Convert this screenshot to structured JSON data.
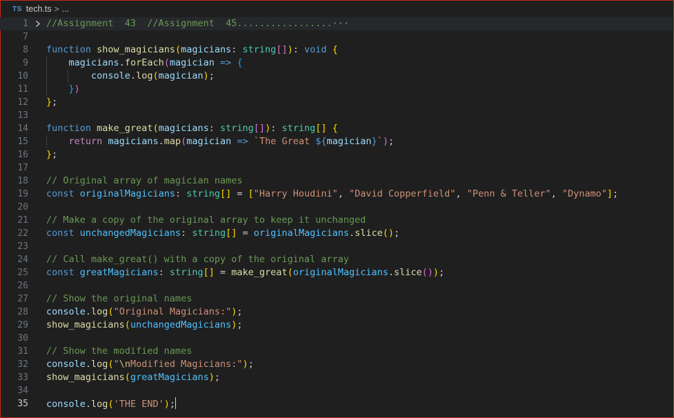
{
  "breadcrumb": {
    "lang_badge": "TS",
    "file": "tech.ts",
    "separator": ">",
    "rest": "..."
  },
  "lines": [
    {
      "n": "1",
      "tokens": [
        {
          "t": "//Assignment  43  //Assignment  45.................",
          "c": "cmt"
        },
        {
          "t": "···",
          "c": "ellipsis"
        }
      ]
    },
    {
      "n": "7",
      "tokens": []
    },
    {
      "n": "8",
      "tokens": [
        {
          "t": "function",
          "c": "kw"
        },
        {
          "t": " "
        },
        {
          "t": "show_magicians",
          "c": "fn"
        },
        {
          "t": "(",
          "c": "b1"
        },
        {
          "t": "magicians",
          "c": "var"
        },
        {
          "t": ": "
        },
        {
          "t": "string",
          "c": "ty"
        },
        {
          "t": "[]",
          "c": "b2"
        },
        {
          "t": ")",
          "c": "b1"
        },
        {
          "t": ": "
        },
        {
          "t": "void",
          "c": "kw"
        },
        {
          "t": " "
        },
        {
          "t": "{",
          "c": "b1"
        }
      ]
    },
    {
      "n": "9",
      "tokens": [
        {
          "t": "    "
        },
        {
          "t": "magicians",
          "c": "var"
        },
        {
          "t": "."
        },
        {
          "t": "forEach",
          "c": "fn"
        },
        {
          "t": "(",
          "c": "b2"
        },
        {
          "t": "magician",
          "c": "var"
        },
        {
          "t": " "
        },
        {
          "t": "=>",
          "c": "kw"
        },
        {
          "t": " "
        },
        {
          "t": "{",
          "c": "b3"
        }
      ]
    },
    {
      "n": "10",
      "tokens": [
        {
          "t": "        "
        },
        {
          "t": "console",
          "c": "var"
        },
        {
          "t": "."
        },
        {
          "t": "log",
          "c": "fn"
        },
        {
          "t": "(",
          "c": "b1"
        },
        {
          "t": "magician",
          "c": "var"
        },
        {
          "t": ")",
          "c": "b1"
        },
        {
          "t": ";"
        }
      ]
    },
    {
      "n": "11",
      "tokens": [
        {
          "t": "    "
        },
        {
          "t": "}",
          "c": "b3"
        },
        {
          "t": ")",
          "c": "b2"
        }
      ]
    },
    {
      "n": "12",
      "tokens": [
        {
          "t": "}",
          "c": "b1"
        },
        {
          "t": ";"
        }
      ]
    },
    {
      "n": "13",
      "tokens": []
    },
    {
      "n": "14",
      "tokens": [
        {
          "t": "function",
          "c": "kw"
        },
        {
          "t": " "
        },
        {
          "t": "make_great",
          "c": "fn"
        },
        {
          "t": "(",
          "c": "b1"
        },
        {
          "t": "magicians",
          "c": "var"
        },
        {
          "t": ": "
        },
        {
          "t": "string",
          "c": "ty"
        },
        {
          "t": "[]",
          "c": "b2"
        },
        {
          "t": ")",
          "c": "b1"
        },
        {
          "t": ": "
        },
        {
          "t": "string",
          "c": "ty"
        },
        {
          "t": "[]",
          "c": "b1"
        },
        {
          "t": " "
        },
        {
          "t": "{",
          "c": "b1"
        }
      ]
    },
    {
      "n": "15",
      "tokens": [
        {
          "t": "    "
        },
        {
          "t": "return",
          "c": "ctl"
        },
        {
          "t": " "
        },
        {
          "t": "magicians",
          "c": "var"
        },
        {
          "t": "."
        },
        {
          "t": "map",
          "c": "fn"
        },
        {
          "t": "(",
          "c": "b2"
        },
        {
          "t": "magician",
          "c": "var"
        },
        {
          "t": " "
        },
        {
          "t": "=>",
          "c": "kw"
        },
        {
          "t": " "
        },
        {
          "t": "`The Great ",
          "c": "str"
        },
        {
          "t": "${",
          "c": "kw"
        },
        {
          "t": "magician",
          "c": "var"
        },
        {
          "t": "}",
          "c": "kw"
        },
        {
          "t": "`",
          "c": "str"
        },
        {
          "t": ")",
          "c": "b2"
        },
        {
          "t": ";"
        }
      ]
    },
    {
      "n": "16",
      "tokens": [
        {
          "t": "}",
          "c": "b1"
        },
        {
          "t": ";"
        }
      ]
    },
    {
      "n": "17",
      "tokens": []
    },
    {
      "n": "18",
      "tokens": [
        {
          "t": "// Original array of magician names",
          "c": "cmt"
        }
      ]
    },
    {
      "n": "19",
      "tokens": [
        {
          "t": "const",
          "c": "kw"
        },
        {
          "t": " "
        },
        {
          "t": "originalMagicians",
          "c": "cst"
        },
        {
          "t": ": "
        },
        {
          "t": "string",
          "c": "ty"
        },
        {
          "t": "[]",
          "c": "b1"
        },
        {
          "t": " = "
        },
        {
          "t": "[",
          "c": "b1"
        },
        {
          "t": "\"Harry Houdini\"",
          "c": "str"
        },
        {
          "t": ", "
        },
        {
          "t": "\"David Copperfield\"",
          "c": "str"
        },
        {
          "t": ", "
        },
        {
          "t": "\"Penn & Teller\"",
          "c": "str"
        },
        {
          "t": ", "
        },
        {
          "t": "\"Dynamo\"",
          "c": "str"
        },
        {
          "t": "]",
          "c": "b1"
        },
        {
          "t": ";"
        }
      ]
    },
    {
      "n": "20",
      "tokens": []
    },
    {
      "n": "21",
      "tokens": [
        {
          "t": "// Make a copy of the original array to keep it unchanged",
          "c": "cmt"
        }
      ]
    },
    {
      "n": "22",
      "tokens": [
        {
          "t": "const",
          "c": "kw"
        },
        {
          "t": " "
        },
        {
          "t": "unchangedMagicians",
          "c": "cst"
        },
        {
          "t": ": "
        },
        {
          "t": "string",
          "c": "ty"
        },
        {
          "t": "[]",
          "c": "b1"
        },
        {
          "t": " = "
        },
        {
          "t": "originalMagicians",
          "c": "cst"
        },
        {
          "t": "."
        },
        {
          "t": "slice",
          "c": "fn"
        },
        {
          "t": "()",
          "c": "b1"
        },
        {
          "t": ";"
        }
      ]
    },
    {
      "n": "23",
      "tokens": []
    },
    {
      "n": "24",
      "tokens": [
        {
          "t": "// Call make_great() with a copy of the original array",
          "c": "cmt"
        }
      ]
    },
    {
      "n": "25",
      "tokens": [
        {
          "t": "const",
          "c": "kw"
        },
        {
          "t": " "
        },
        {
          "t": "greatMagicians",
          "c": "cst"
        },
        {
          "t": ": "
        },
        {
          "t": "string",
          "c": "ty"
        },
        {
          "t": "[]",
          "c": "b1"
        },
        {
          "t": " = "
        },
        {
          "t": "make_great",
          "c": "fn"
        },
        {
          "t": "(",
          "c": "b1"
        },
        {
          "t": "originalMagicians",
          "c": "cst"
        },
        {
          "t": "."
        },
        {
          "t": "slice",
          "c": "fn"
        },
        {
          "t": "()",
          "c": "b2"
        },
        {
          "t": ")",
          "c": "b1"
        },
        {
          "t": ";"
        }
      ]
    },
    {
      "n": "26",
      "tokens": []
    },
    {
      "n": "27",
      "tokens": [
        {
          "t": "// Show the original names",
          "c": "cmt"
        }
      ]
    },
    {
      "n": "28",
      "tokens": [
        {
          "t": "console",
          "c": "var"
        },
        {
          "t": "."
        },
        {
          "t": "log",
          "c": "fn"
        },
        {
          "t": "(",
          "c": "b1"
        },
        {
          "t": "\"Original Magicians:\"",
          "c": "str"
        },
        {
          "t": ")",
          "c": "b1"
        },
        {
          "t": ";"
        }
      ]
    },
    {
      "n": "29",
      "tokens": [
        {
          "t": "show_magicians",
          "c": "fn"
        },
        {
          "t": "(",
          "c": "b1"
        },
        {
          "t": "unchangedMagicians",
          "c": "cst"
        },
        {
          "t": ")",
          "c": "b1"
        },
        {
          "t": ";"
        }
      ]
    },
    {
      "n": "30",
      "tokens": []
    },
    {
      "n": "31",
      "tokens": [
        {
          "t": "// Show the modified names",
          "c": "cmt"
        }
      ]
    },
    {
      "n": "32",
      "tokens": [
        {
          "t": "console",
          "c": "var"
        },
        {
          "t": "."
        },
        {
          "t": "log",
          "c": "fn"
        },
        {
          "t": "(",
          "c": "b1"
        },
        {
          "t": "\"",
          "c": "str"
        },
        {
          "t": "\\n",
          "c": "esc"
        },
        {
          "t": "Modified Magicians:\"",
          "c": "str"
        },
        {
          "t": ")",
          "c": "b1"
        },
        {
          "t": ";"
        }
      ]
    },
    {
      "n": "33",
      "tokens": [
        {
          "t": "show_magicians",
          "c": "fn"
        },
        {
          "t": "(",
          "c": "b1"
        },
        {
          "t": "greatMagicians",
          "c": "cst"
        },
        {
          "t": ")",
          "c": "b1"
        },
        {
          "t": ";"
        }
      ]
    },
    {
      "n": "34",
      "tokens": []
    },
    {
      "n": "35",
      "tokens": [
        {
          "t": "console",
          "c": "var"
        },
        {
          "t": "."
        },
        {
          "t": "log",
          "c": "fn"
        },
        {
          "t": "(",
          "c": "b1"
        },
        {
          "t": "'THE END'",
          "c": "str"
        },
        {
          "t": ")",
          "c": "b1"
        },
        {
          "t": ";"
        }
      ]
    }
  ],
  "active_line": "35",
  "folded_line": "1",
  "fold_icon": "chevron-right-icon",
  "colors": {
    "background": "#1f1f1f",
    "frame_border": "#c42b1c",
    "keyword": "#569cd6",
    "function": "#dcdcaa",
    "variable": "#9cdcfe",
    "constant": "#4fc1ff",
    "type": "#4ec9b0",
    "string": "#ce9178",
    "comment": "#6a9955"
  }
}
